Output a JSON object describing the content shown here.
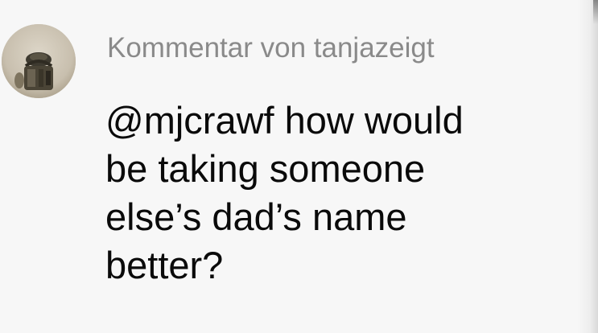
{
  "comment": {
    "header": "Kommentar von tanjazeigt",
    "body": "@mjcrawf how would\nbe taking someone\nelse’s dad’s name\nbetter?"
  },
  "icons": {
    "avatar": "user-avatar-photo"
  },
  "colors": {
    "background": "#f7f7f7",
    "header_text": "#8a8a8a",
    "body_text": "#0a0a0a"
  }
}
